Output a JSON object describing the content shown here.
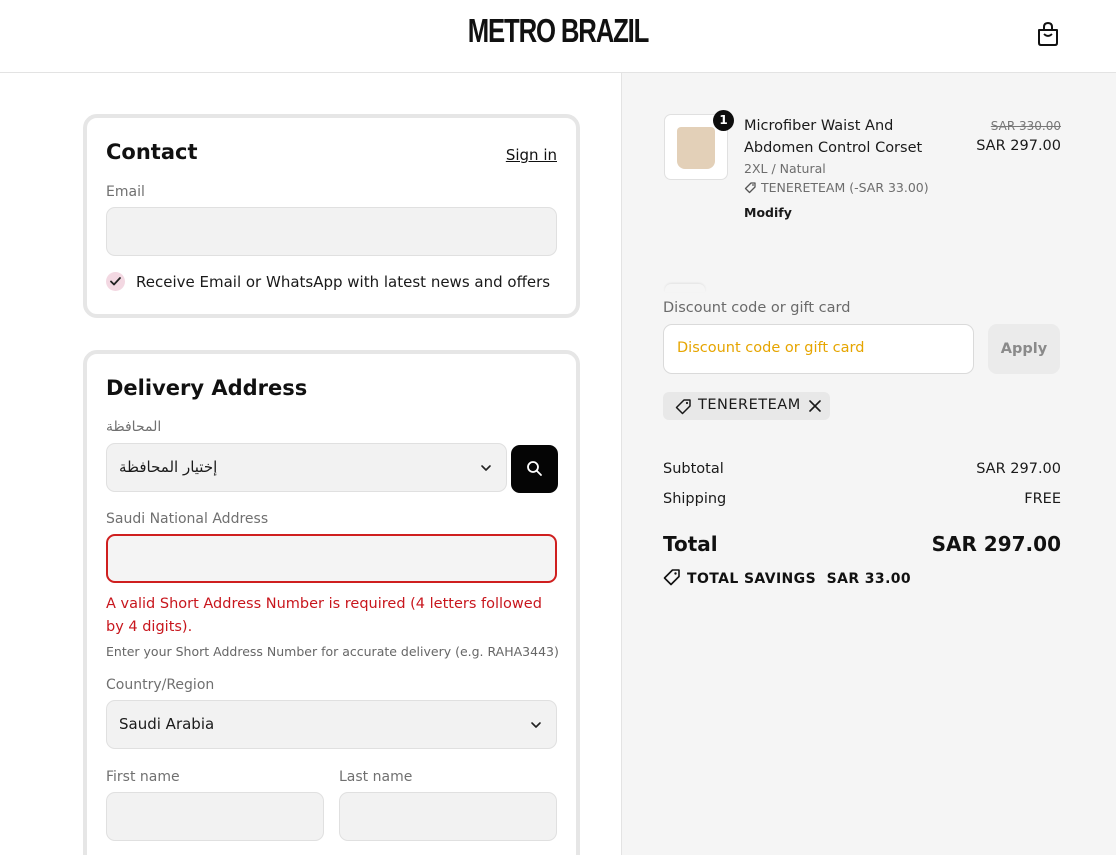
{
  "header": {
    "brand": "METRO BRAZIL",
    "cart_icon": "shopping-bag-icon"
  },
  "contact": {
    "title": "Contact",
    "sign_in": "Sign in",
    "email_label": "Email",
    "email_value": "",
    "marketing_label": "Receive Email or WhatsApp with latest news and offers",
    "marketing_checked": true
  },
  "delivery": {
    "title": "Delivery Address",
    "province_label": "المحافظة",
    "province_value": "إختيار المحافظة",
    "search_icon": "search-icon",
    "national_address_label": "Saudi National Address",
    "national_address_value": "",
    "error": "A valid Short Address Number is required (4 letters followed by 4 digits).",
    "help": "Enter your Short Address Number for accurate delivery (e.g. RAHA3443)",
    "country_label": "Country/Region",
    "country_value": "Saudi Arabia",
    "first_name_label": "First name",
    "last_name_label": "Last name"
  },
  "order": {
    "item": {
      "quantity": "1",
      "name": "Microfiber Waist And Abdomen Control Corset",
      "variant": "2XL / Natural",
      "discount": "TENERETEAM (-SAR 33.00)",
      "modify": "Modify",
      "price_original": "SAR 330.00",
      "price": "SAR 297.00"
    },
    "discount_label": "Discount code or gift card",
    "discount_placeholder": "Discount code or gift card",
    "apply": "Apply",
    "applied_code": "TENERETEAM",
    "subtotal_label": "Subtotal",
    "subtotal_value": "SAR 297.00",
    "shipping_label": "Shipping",
    "shipping_value": "FREE",
    "total_label": "Total",
    "total_value": "SAR 297.00",
    "savings_label": "TOTAL SAVINGS",
    "savings_value": "SAR 33.00"
  },
  "colors": {
    "error": "#c8161d",
    "placeholder_accent": "#e6a500",
    "primary_button": "#050505"
  }
}
